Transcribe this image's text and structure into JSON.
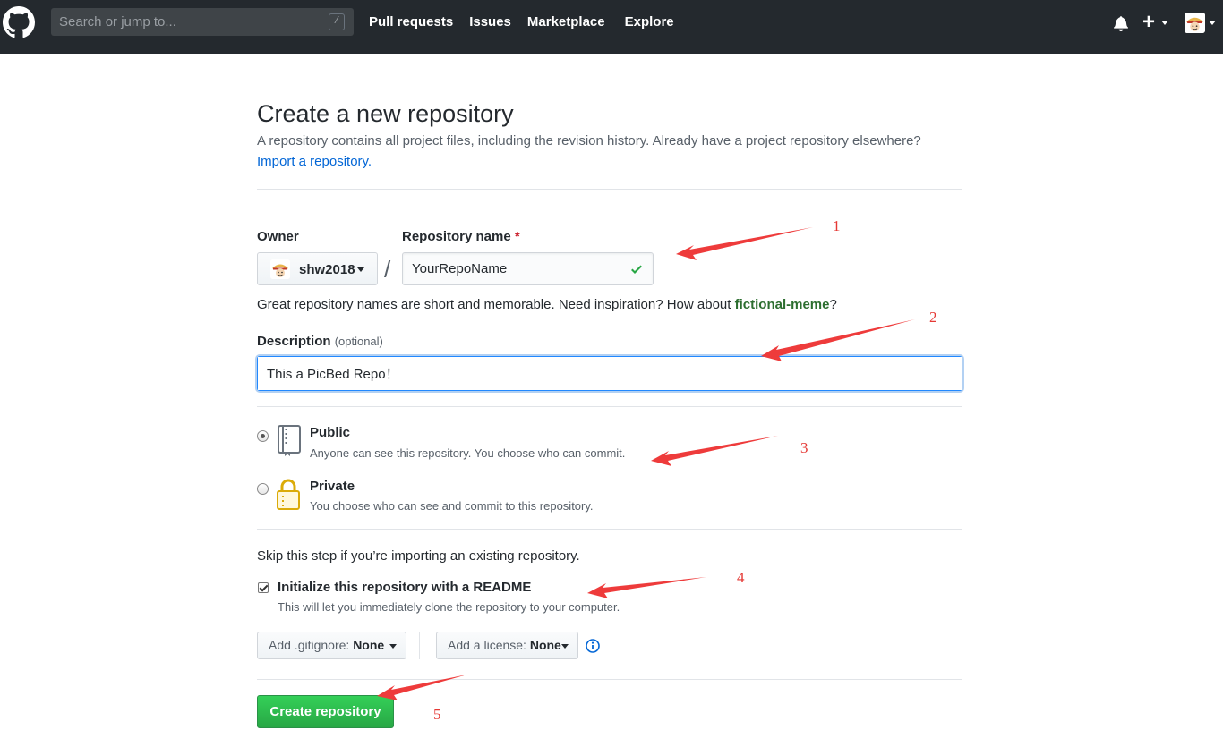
{
  "header": {
    "search_placeholder": "Search or jump to...",
    "slash_key": "/",
    "nav": [
      "Pull requests",
      "Issues",
      "Marketplace",
      "Explore"
    ],
    "plus": "+"
  },
  "page": {
    "title": "Create a new repository",
    "subtitle": "A repository contains all project files, including the revision history. Already have a project repository elsewhere?",
    "import_link": "Import a repository."
  },
  "form": {
    "owner_label": "Owner",
    "owner_value": "shw2018",
    "repo_label": "Repository name",
    "required_mark": "*",
    "separator": "/",
    "repo_value": "YourRepoName",
    "hint_text": "Great repository names are short and memorable. Need inspiration? How about ",
    "hint_suggestion": "fictional-meme",
    "hint_end": "?",
    "desc_label": "Description",
    "desc_optional": "(optional)",
    "desc_value": "This a PicBed Repo！",
    "visibility": [
      {
        "title": "Public",
        "desc": "Anyone can see this repository. You choose who can commit.",
        "selected": true
      },
      {
        "title": "Private",
        "desc": "You choose who can see and commit to this repository.",
        "selected": false
      }
    ],
    "skip_text": "Skip this step if you’re importing an existing repository.",
    "readme_label": "Initialize this repository with a README",
    "readme_note": "This will let you immediately clone the repository to your computer.",
    "readme_checked": true,
    "gitignore_prefix": "Add .gitignore:",
    "gitignore_value": "None",
    "license_prefix": "Add a license:",
    "license_value": "None",
    "create_button": "Create repository"
  },
  "annotations": [
    "1",
    "2",
    "3",
    "4",
    "5"
  ],
  "colors": {
    "header_bg": "#24292e",
    "link": "#0366d6",
    "create_green": "#28a745",
    "annotation_red": "#e53935"
  }
}
